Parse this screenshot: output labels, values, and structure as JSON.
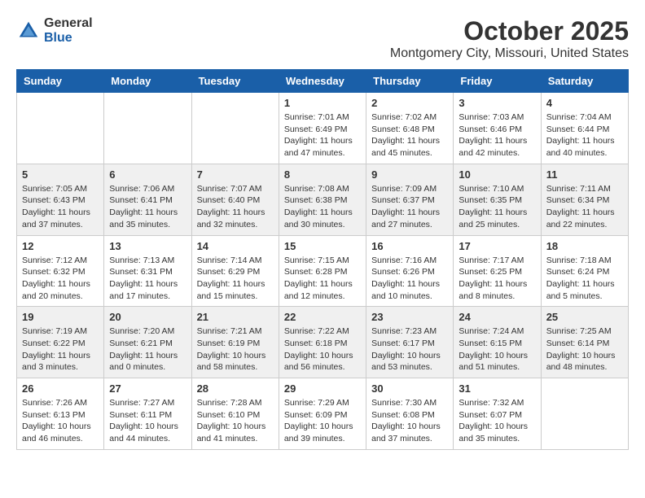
{
  "header": {
    "logo_general": "General",
    "logo_blue": "Blue",
    "month_title": "October 2025",
    "location": "Montgomery City, Missouri, United States"
  },
  "weekdays": [
    "Sunday",
    "Monday",
    "Tuesday",
    "Wednesday",
    "Thursday",
    "Friday",
    "Saturday"
  ],
  "weeks": [
    [
      {
        "day": "",
        "sunrise": "",
        "sunset": "",
        "daylight": ""
      },
      {
        "day": "",
        "sunrise": "",
        "sunset": "",
        "daylight": ""
      },
      {
        "day": "",
        "sunrise": "",
        "sunset": "",
        "daylight": ""
      },
      {
        "day": "1",
        "sunrise": "Sunrise: 7:01 AM",
        "sunset": "Sunset: 6:49 PM",
        "daylight": "Daylight: 11 hours and 47 minutes."
      },
      {
        "day": "2",
        "sunrise": "Sunrise: 7:02 AM",
        "sunset": "Sunset: 6:48 PM",
        "daylight": "Daylight: 11 hours and 45 minutes."
      },
      {
        "day": "3",
        "sunrise": "Sunrise: 7:03 AM",
        "sunset": "Sunset: 6:46 PM",
        "daylight": "Daylight: 11 hours and 42 minutes."
      },
      {
        "day": "4",
        "sunrise": "Sunrise: 7:04 AM",
        "sunset": "Sunset: 6:44 PM",
        "daylight": "Daylight: 11 hours and 40 minutes."
      }
    ],
    [
      {
        "day": "5",
        "sunrise": "Sunrise: 7:05 AM",
        "sunset": "Sunset: 6:43 PM",
        "daylight": "Daylight: 11 hours and 37 minutes."
      },
      {
        "day": "6",
        "sunrise": "Sunrise: 7:06 AM",
        "sunset": "Sunset: 6:41 PM",
        "daylight": "Daylight: 11 hours and 35 minutes."
      },
      {
        "day": "7",
        "sunrise": "Sunrise: 7:07 AM",
        "sunset": "Sunset: 6:40 PM",
        "daylight": "Daylight: 11 hours and 32 minutes."
      },
      {
        "day": "8",
        "sunrise": "Sunrise: 7:08 AM",
        "sunset": "Sunset: 6:38 PM",
        "daylight": "Daylight: 11 hours and 30 minutes."
      },
      {
        "day": "9",
        "sunrise": "Sunrise: 7:09 AM",
        "sunset": "Sunset: 6:37 PM",
        "daylight": "Daylight: 11 hours and 27 minutes."
      },
      {
        "day": "10",
        "sunrise": "Sunrise: 7:10 AM",
        "sunset": "Sunset: 6:35 PM",
        "daylight": "Daylight: 11 hours and 25 minutes."
      },
      {
        "day": "11",
        "sunrise": "Sunrise: 7:11 AM",
        "sunset": "Sunset: 6:34 PM",
        "daylight": "Daylight: 11 hours and 22 minutes."
      }
    ],
    [
      {
        "day": "12",
        "sunrise": "Sunrise: 7:12 AM",
        "sunset": "Sunset: 6:32 PM",
        "daylight": "Daylight: 11 hours and 20 minutes."
      },
      {
        "day": "13",
        "sunrise": "Sunrise: 7:13 AM",
        "sunset": "Sunset: 6:31 PM",
        "daylight": "Daylight: 11 hours and 17 minutes."
      },
      {
        "day": "14",
        "sunrise": "Sunrise: 7:14 AM",
        "sunset": "Sunset: 6:29 PM",
        "daylight": "Daylight: 11 hours and 15 minutes."
      },
      {
        "day": "15",
        "sunrise": "Sunrise: 7:15 AM",
        "sunset": "Sunset: 6:28 PM",
        "daylight": "Daylight: 11 hours and 12 minutes."
      },
      {
        "day": "16",
        "sunrise": "Sunrise: 7:16 AM",
        "sunset": "Sunset: 6:26 PM",
        "daylight": "Daylight: 11 hours and 10 minutes."
      },
      {
        "day": "17",
        "sunrise": "Sunrise: 7:17 AM",
        "sunset": "Sunset: 6:25 PM",
        "daylight": "Daylight: 11 hours and 8 minutes."
      },
      {
        "day": "18",
        "sunrise": "Sunrise: 7:18 AM",
        "sunset": "Sunset: 6:24 PM",
        "daylight": "Daylight: 11 hours and 5 minutes."
      }
    ],
    [
      {
        "day": "19",
        "sunrise": "Sunrise: 7:19 AM",
        "sunset": "Sunset: 6:22 PM",
        "daylight": "Daylight: 11 hours and 3 minutes."
      },
      {
        "day": "20",
        "sunrise": "Sunrise: 7:20 AM",
        "sunset": "Sunset: 6:21 PM",
        "daylight": "Daylight: 11 hours and 0 minutes."
      },
      {
        "day": "21",
        "sunrise": "Sunrise: 7:21 AM",
        "sunset": "Sunset: 6:19 PM",
        "daylight": "Daylight: 10 hours and 58 minutes."
      },
      {
        "day": "22",
        "sunrise": "Sunrise: 7:22 AM",
        "sunset": "Sunset: 6:18 PM",
        "daylight": "Daylight: 10 hours and 56 minutes."
      },
      {
        "day": "23",
        "sunrise": "Sunrise: 7:23 AM",
        "sunset": "Sunset: 6:17 PM",
        "daylight": "Daylight: 10 hours and 53 minutes."
      },
      {
        "day": "24",
        "sunrise": "Sunrise: 7:24 AM",
        "sunset": "Sunset: 6:15 PM",
        "daylight": "Daylight: 10 hours and 51 minutes."
      },
      {
        "day": "25",
        "sunrise": "Sunrise: 7:25 AM",
        "sunset": "Sunset: 6:14 PM",
        "daylight": "Daylight: 10 hours and 48 minutes."
      }
    ],
    [
      {
        "day": "26",
        "sunrise": "Sunrise: 7:26 AM",
        "sunset": "Sunset: 6:13 PM",
        "daylight": "Daylight: 10 hours and 46 minutes."
      },
      {
        "day": "27",
        "sunrise": "Sunrise: 7:27 AM",
        "sunset": "Sunset: 6:11 PM",
        "daylight": "Daylight: 10 hours and 44 minutes."
      },
      {
        "day": "28",
        "sunrise": "Sunrise: 7:28 AM",
        "sunset": "Sunset: 6:10 PM",
        "daylight": "Daylight: 10 hours and 41 minutes."
      },
      {
        "day": "29",
        "sunrise": "Sunrise: 7:29 AM",
        "sunset": "Sunset: 6:09 PM",
        "daylight": "Daylight: 10 hours and 39 minutes."
      },
      {
        "day": "30",
        "sunrise": "Sunrise: 7:30 AM",
        "sunset": "Sunset: 6:08 PM",
        "daylight": "Daylight: 10 hours and 37 minutes."
      },
      {
        "day": "31",
        "sunrise": "Sunrise: 7:32 AM",
        "sunset": "Sunset: 6:07 PM",
        "daylight": "Daylight: 10 hours and 35 minutes."
      },
      {
        "day": "",
        "sunrise": "",
        "sunset": "",
        "daylight": ""
      }
    ]
  ]
}
